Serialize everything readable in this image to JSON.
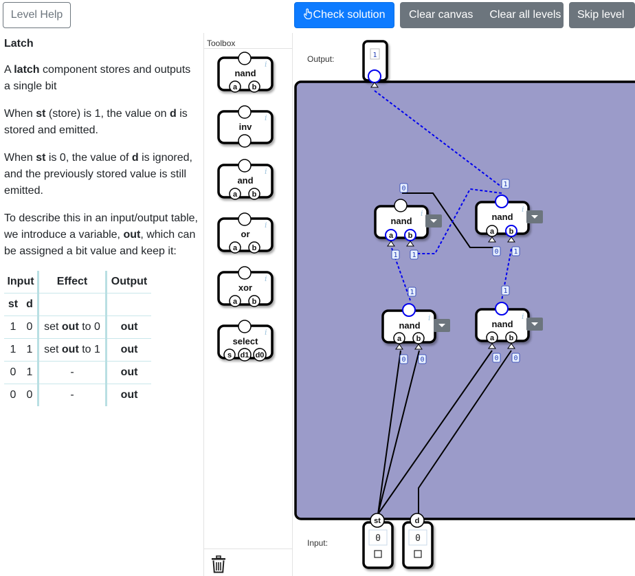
{
  "buttons": {
    "level_help": "Level Help",
    "check_solution": "Check solution",
    "clear_canvas": "Clear canvas",
    "clear_all_levels": "Clear all levels",
    "skip_level": "Skip level"
  },
  "help": {
    "title": "Latch",
    "p1_pre": "A ",
    "p1_bold": "latch",
    "p1_post": " component stores and outputs a single bit",
    "p2_a": "When ",
    "p2_b": "st",
    "p2_c": " (store) is 1, the value on ",
    "p2_d": "d",
    "p2_e": " is stored and emitted.",
    "p3_a": "When ",
    "p3_b": "st",
    "p3_c": " is 0, the value of ",
    "p3_d": "d",
    "p3_e": " is ignored, and the previously stored value is still emitted.",
    "p4_a": "To describe this in an input/output table, we introduce a variable, ",
    "p4_b": "out",
    "p4_c": ", which can be assigned a bit value and keep it:",
    "table": {
      "h_input": "Input",
      "h_effect": "Effect",
      "h_output": "Output",
      "h_st": "st",
      "h_d": "d",
      "rows": [
        {
          "st": "1",
          "d": "0",
          "effect_pre": "set ",
          "effect_bold": "out",
          "effect_post": " to 0",
          "output": "out"
        },
        {
          "st": "1",
          "d": "1",
          "effect_pre": "set ",
          "effect_bold": "out",
          "effect_post": " to 1",
          "output": "out"
        },
        {
          "st": "0",
          "d": "1",
          "effect_pre": "-",
          "effect_bold": "",
          "effect_post": "",
          "output": "out"
        },
        {
          "st": "0",
          "d": "0",
          "effect_pre": "-",
          "effect_bold": "",
          "effect_post": "",
          "output": "out"
        }
      ]
    }
  },
  "toolbox": {
    "label": "Toolbox",
    "components": [
      {
        "name": "nand",
        "pins": [
          "a",
          "b"
        ]
      },
      {
        "name": "inv",
        "pins": []
      },
      {
        "name": "and",
        "pins": [
          "a",
          "b"
        ]
      },
      {
        "name": "or",
        "pins": [
          "a",
          "b"
        ]
      },
      {
        "name": "xor",
        "pins": [
          "a",
          "b"
        ]
      },
      {
        "name": "select",
        "pins": [
          "s",
          "d1",
          "d0"
        ]
      }
    ]
  },
  "canvas": {
    "output_label": "Output:",
    "input_label": "Input:",
    "output_value": "1",
    "gates": [
      {
        "name": "nand",
        "pins": [
          "a",
          "b"
        ],
        "a_value": "1",
        "b_value": "1",
        "out_value": "0"
      },
      {
        "name": "nand",
        "pins": [
          "a",
          "b"
        ],
        "a_value": "0",
        "b_value": "1",
        "out_value": "1"
      },
      {
        "name": "nand",
        "pins": [
          "a",
          "b"
        ],
        "a_value": "0",
        "b_value": "0",
        "out_value": "1"
      },
      {
        "name": "nand",
        "pins": [
          "a",
          "b"
        ],
        "a_value": "0",
        "b_value": "0",
        "out_value": "1"
      }
    ],
    "inputs": [
      {
        "name": "st",
        "value": "0"
      },
      {
        "name": "d",
        "value": "0"
      }
    ]
  },
  "icons": {
    "check": "hand-pointer-icon",
    "info": "info-icon",
    "dropdown": "caret-down-icon",
    "trash": "trash-icon",
    "checkbox": "checkbox-icon"
  },
  "colors": {
    "canvas_bg": "#9b9bc9",
    "primary": "#0d7bff",
    "secondary": "#6c757d",
    "active_wire": "#0000ee",
    "inactive_wire": "#000000"
  }
}
